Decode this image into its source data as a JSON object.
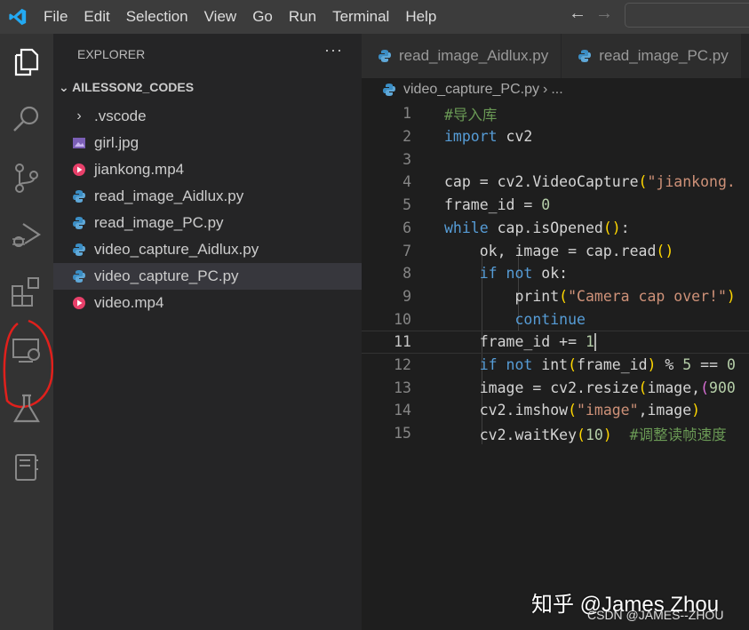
{
  "titlebar": {
    "menus": [
      "File",
      "Edit",
      "Selection",
      "View",
      "Go",
      "Run",
      "Terminal",
      "Help"
    ],
    "back_icon": "arrow-left-icon",
    "forward_icon": "arrow-right-icon"
  },
  "activity_bar": [
    "files-icon",
    "search-icon",
    "source-control-icon",
    "run-debug-icon",
    "extensions-icon",
    "remote-explorer-icon",
    "testing-flask-icon",
    "notebook-icon"
  ],
  "annotation_color": "#e0201c",
  "sidebar": {
    "title": "EXPLORER",
    "more": "···",
    "root": "AILESSON2_CODES",
    "items": [
      {
        "label": ".vscode",
        "type": "folder"
      },
      {
        "label": "girl.jpg",
        "type": "image"
      },
      {
        "label": "jiankong.mp4",
        "type": "video"
      },
      {
        "label": "read_image_Aidlux.py",
        "type": "python"
      },
      {
        "label": "read_image_PC.py",
        "type": "python"
      },
      {
        "label": "video_capture_Aidlux.py",
        "type": "python"
      },
      {
        "label": "video_capture_PC.py",
        "type": "python",
        "selected": true
      },
      {
        "label": "video.mp4",
        "type": "video"
      }
    ]
  },
  "tabs": [
    "read_image_Aidlux.py",
    "read_image_PC.py"
  ],
  "breadcrumb": {
    "file": "video_capture_PC.py",
    "sep": "›",
    "rest": "..."
  },
  "editor": {
    "current_line": 11,
    "lines": [
      {
        "n": "1",
        "t": [
          [
            "#导入库",
            "cm"
          ]
        ]
      },
      {
        "n": "2",
        "t": [
          [
            "import",
            "kw"
          ],
          [
            " cv2",
            "pl"
          ]
        ]
      },
      {
        "n": "3",
        "t": []
      },
      {
        "n": "4",
        "t": [
          [
            "cap = cv2.VideoCapture",
            "pl"
          ],
          [
            "(",
            "br"
          ],
          [
            "\"jiankong.",
            "str"
          ]
        ]
      },
      {
        "n": "5",
        "t": [
          [
            "frame_id = ",
            "pl"
          ],
          [
            "0",
            "num"
          ]
        ]
      },
      {
        "n": "6",
        "t": [
          [
            "while",
            "kw"
          ],
          [
            " cap.isOpened",
            "pl"
          ],
          [
            "()",
            "br"
          ],
          [
            ":",
            "pl"
          ]
        ]
      },
      {
        "n": "7",
        "t": [
          [
            "    ok, image = cap.read",
            "pl"
          ],
          [
            "()",
            "br"
          ]
        ]
      },
      {
        "n": "8",
        "t": [
          [
            "    ",
            "pl"
          ],
          [
            "if not",
            "kw"
          ],
          [
            " ok:",
            "pl"
          ]
        ]
      },
      {
        "n": "9",
        "t": [
          [
            "        print",
            "pl"
          ],
          [
            "(",
            "br"
          ],
          [
            "\"Camera cap over!\"",
            "str"
          ],
          [
            ")",
            "br"
          ]
        ]
      },
      {
        "n": "10",
        "t": [
          [
            "        ",
            "pl"
          ],
          [
            "continue",
            "kw"
          ]
        ]
      },
      {
        "n": "11",
        "t": [
          [
            "    frame_id += ",
            "pl"
          ],
          [
            "1",
            "num"
          ]
        ]
      },
      {
        "n": "12",
        "t": [
          [
            "    ",
            "pl"
          ],
          [
            "if not",
            "kw"
          ],
          [
            " int",
            "pl"
          ],
          [
            "(",
            "br"
          ],
          [
            "frame_id",
            "pl"
          ],
          [
            ")",
            "br"
          ],
          [
            " % ",
            "pl"
          ],
          [
            "5",
            "num"
          ],
          [
            " == ",
            "pl"
          ],
          [
            "0",
            "num"
          ]
        ]
      },
      {
        "n": "13",
        "t": [
          [
            "    image = cv2.resize",
            "pl"
          ],
          [
            "(",
            "br"
          ],
          [
            "image,",
            "pl"
          ],
          [
            "(",
            "br2"
          ],
          [
            "900",
            "num"
          ]
        ]
      },
      {
        "n": "14",
        "t": [
          [
            "    cv2.imshow",
            "pl"
          ],
          [
            "(",
            "br"
          ],
          [
            "\"image\"",
            "str"
          ],
          [
            ",image",
            "pl"
          ],
          [
            ")",
            "br"
          ]
        ]
      },
      {
        "n": "15",
        "t": [
          [
            "    cv2.waitKey",
            "pl"
          ],
          [
            "(",
            "br"
          ],
          [
            "10",
            "num"
          ],
          [
            ")",
            "br"
          ],
          [
            "  ",
            "pl"
          ],
          [
            "#调整读帧速度",
            "cm"
          ]
        ]
      }
    ]
  },
  "watermark": {
    "zhihu": "知乎 @James Zhou",
    "csdn": "CSDN @JAMES--ZHOU"
  }
}
